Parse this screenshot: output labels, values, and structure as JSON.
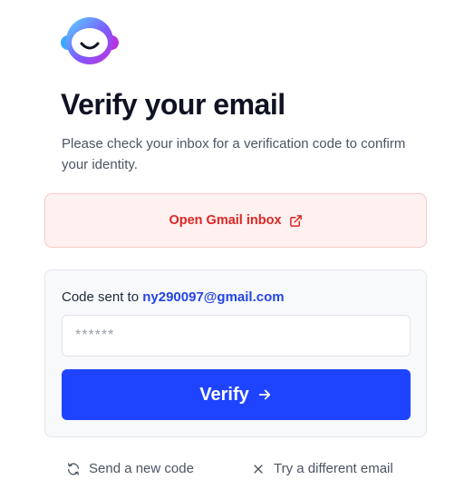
{
  "logo": {
    "icon": "smiling-face-logo",
    "colors": [
      "#4fd1ff",
      "#7b61ff",
      "#c026d3"
    ]
  },
  "header": {
    "title": "Verify your email",
    "subtitle": "Please check your inbox for a verification code to confirm your identity."
  },
  "gmail": {
    "label": "Open Gmail inbox",
    "icon": "external-link-icon",
    "color": "#dc2626"
  },
  "code_card": {
    "sent_prefix": "Code sent to",
    "email": "ny290097@gmail.com",
    "input_placeholder": "******",
    "input_value": "",
    "verify_label": "Verify",
    "verify_icon": "arrow-right-icon",
    "accent": "#1f44ff"
  },
  "footer": {
    "resend_label": "Send a new code",
    "resend_icon": "refresh-icon",
    "different_label": "Try a different email",
    "different_icon": "close-icon"
  }
}
